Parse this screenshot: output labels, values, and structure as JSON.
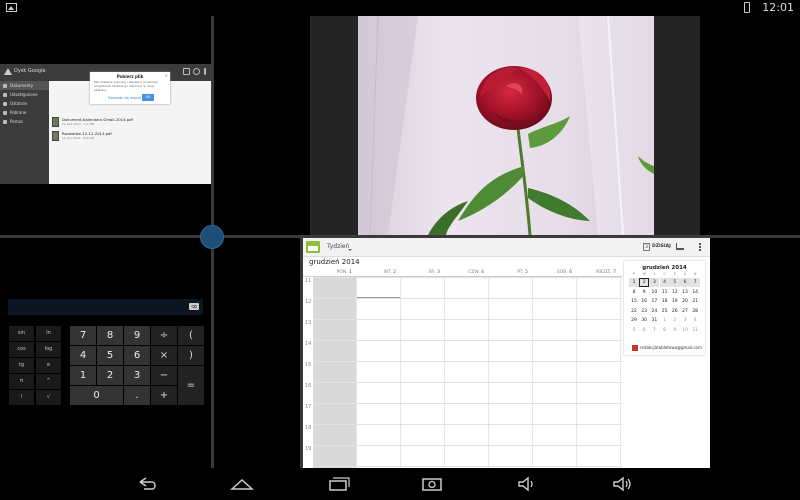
{
  "status_bar": {
    "time": "12:01"
  },
  "drive": {
    "title": "Dysk Google",
    "sidebar": [
      {
        "label": "Dokumenty"
      },
      {
        "label": "Udostępnione"
      },
      {
        "label": "Ostatnie"
      },
      {
        "label": "Pobrane"
      },
      {
        "label": "Pomoc"
      }
    ],
    "dialog": {
      "title": "Pobierz plik",
      "text": "Plik zostanie pobrany i zapisany w pamięci urządzenia. Możesz go otworzyć w innej aplikacji.",
      "link": "Dowiedz się więcej",
      "ok": "OK"
    },
    "files": [
      {
        "name": "Dokument-Kalendarz-Gmail-2014.pdf",
        "meta": "12 paź 2014 · 1,2 MB"
      },
      {
        "name": "Rozwadze-12-12-2014.pdf",
        "meta": "12 gru 2014 · 840 KB"
      }
    ]
  },
  "photo": {
    "description": "red rose"
  },
  "calculator": {
    "sci_keys": [
      "sin",
      "ln",
      "cos",
      "log",
      "tg",
      "e",
      "π",
      "^",
      "!",
      "√"
    ],
    "num_rows": [
      [
        "7",
        "8",
        "9"
      ],
      [
        "4",
        "5",
        "6"
      ],
      [
        "1",
        "2",
        "3"
      ],
      [
        "0",
        "."
      ]
    ],
    "op_keys": [
      "÷",
      "(",
      "×",
      ")",
      "−",
      "+",
      "="
    ],
    "delete_label": "⌫"
  },
  "calendar": {
    "view_selector": "Tydzień",
    "today_label": "DZISIAJ",
    "today_icon_num": "3",
    "month_title": "grudzień 2014",
    "day_headers": [
      {
        "name": "PON.",
        "num": "1"
      },
      {
        "name": "WT.",
        "num": "2"
      },
      {
        "name": "ŚR.",
        "num": "3"
      },
      {
        "name": "CZW.",
        "num": "4"
      },
      {
        "name": "PT.",
        "num": "5"
      },
      {
        "name": "SOB.",
        "num": "6"
      },
      {
        "name": "NIEDZ.",
        "num": "7"
      }
    ],
    "hours": [
      "11",
      "12",
      "13",
      "14",
      "15",
      "16",
      "17",
      "18",
      "19"
    ],
    "mini": {
      "title": "grudzień 2014",
      "weekday_initials": [
        "P",
        "W",
        "Ś",
        "C",
        "P",
        "S",
        "N"
      ],
      "weeks": [
        [
          "1",
          "2",
          "3",
          "4",
          "5",
          "6",
          "7"
        ],
        [
          "8",
          "9",
          "10",
          "11",
          "12",
          "13",
          "14"
        ],
        [
          "15",
          "16",
          "17",
          "18",
          "19",
          "20",
          "21"
        ],
        [
          "22",
          "23",
          "24",
          "25",
          "26",
          "27",
          "28"
        ],
        [
          "29",
          "30",
          "31",
          "1",
          "2",
          "3",
          "4"
        ],
        [
          "5",
          "6",
          "7",
          "8",
          "9",
          "10",
          "11"
        ]
      ],
      "today": "2"
    },
    "account_email": "redakcjatabletowa@gmail.com",
    "account_color": "#c0392b"
  },
  "colors": {
    "split_handle": "#1d4e78",
    "calendar_accent": "#8fbf3a"
  }
}
